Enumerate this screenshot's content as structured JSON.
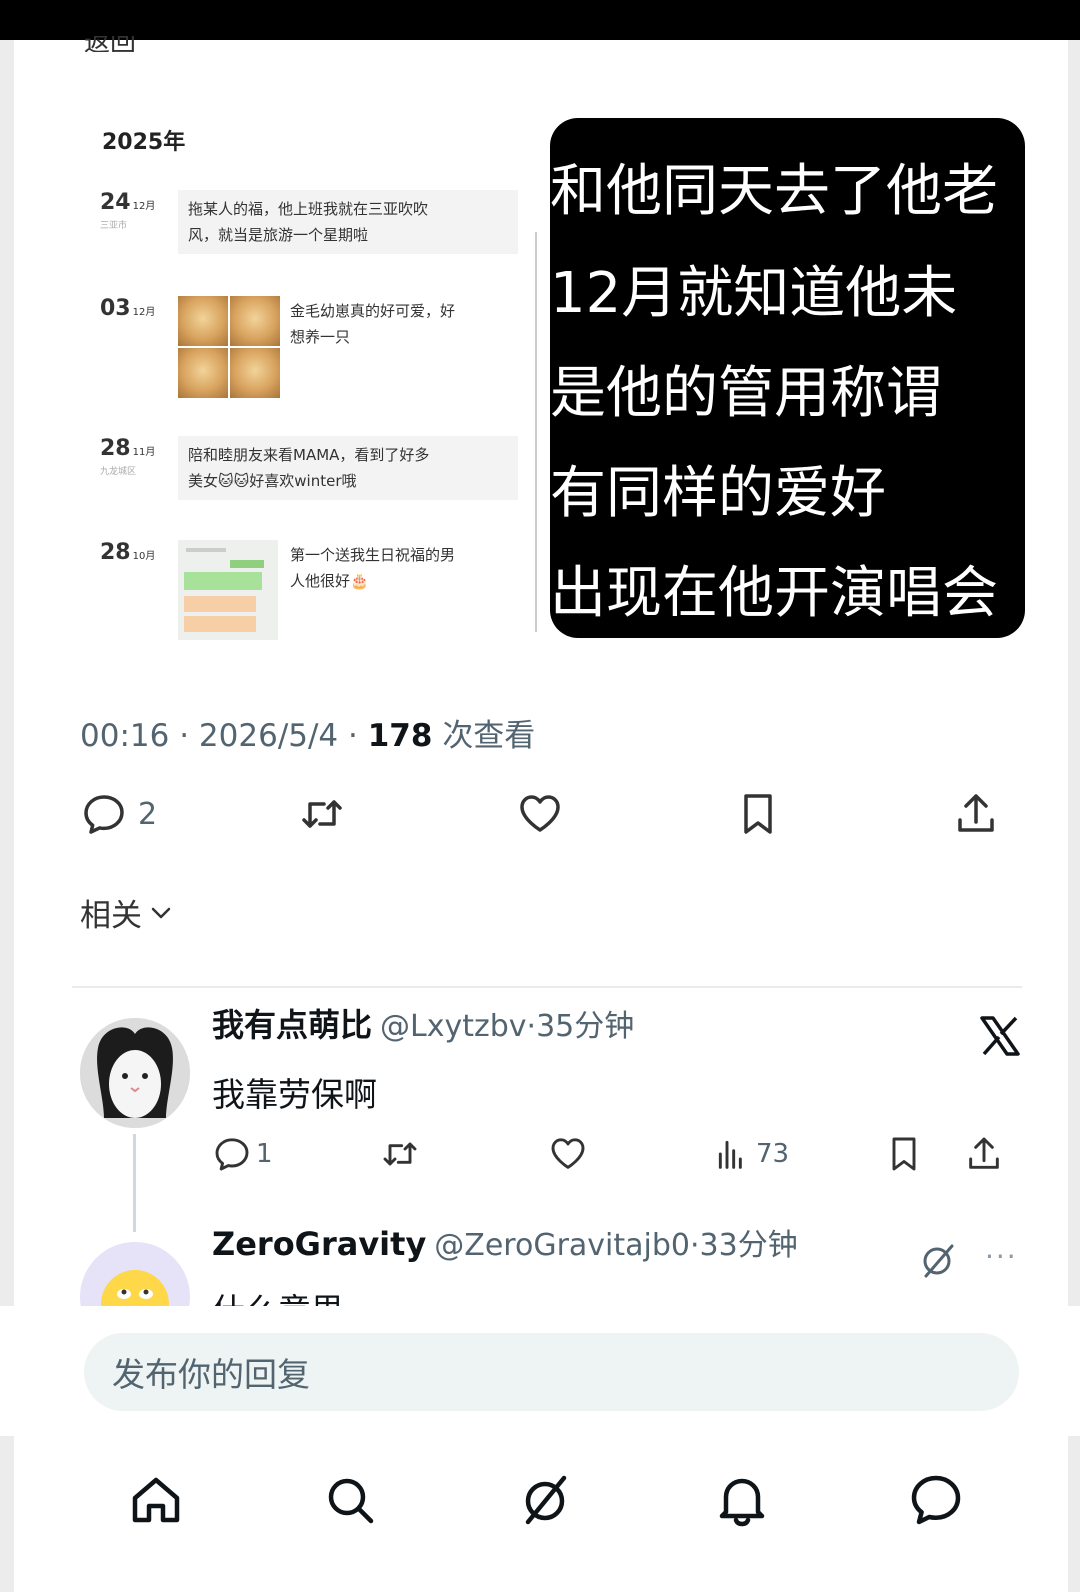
{
  "nav_top": {
    "back_fragment": "返回"
  },
  "media": {
    "moments": {
      "year": "2025年",
      "items": [
        {
          "day": "24",
          "month": "12月",
          "location": "三亚市",
          "text_line1": "拖某人的福，他上班我就在三亚吹吹",
          "text_line2": "风，就当是旅游一个星期啦"
        },
        {
          "day": "03",
          "month": "12月",
          "text_line1": "金毛幼崽真的好可爱，好",
          "text_line2": "想养一只"
        },
        {
          "day": "28",
          "month": "11月",
          "location": "九龙城区",
          "text_line1": "陪和睦朋友来看MAMA，看到了好多",
          "text_line2": "美女🐱🐱好喜欢winter哦"
        },
        {
          "day": "28",
          "month": "10月",
          "text_line1": "第一个送我生日祝福的男",
          "text_line2": "人他很好🎂"
        }
      ]
    },
    "lyric_lines": [
      "和他同天去了他老",
      "12月就知道他未",
      "是他的管用称谓",
      "有同样的爱好",
      "出现在他开演唱会"
    ]
  },
  "post_meta": {
    "time": "00:16",
    "date": "2026/5/4",
    "views": "178",
    "views_label": "次查看",
    "sep": "·"
  },
  "post_actions": {
    "reply_count": "2"
  },
  "related": {
    "label": "相关"
  },
  "replies": [
    {
      "name": "我有点萌比",
      "handle": "@Lxytzbv",
      "time": "·35分钟",
      "text": "我靠劳保啊",
      "reply_count": "1",
      "views": "73"
    },
    {
      "name": "ZeroGravity",
      "handle": "@ZeroGravitajb0",
      "time": "·33分钟",
      "text_fragment": "什么意思"
    }
  ],
  "reply_input": {
    "placeholder": "发布你的回复"
  },
  "colors": {
    "accent": "#0f1419",
    "muted": "#536471",
    "reply_box": "#eef4f3"
  }
}
